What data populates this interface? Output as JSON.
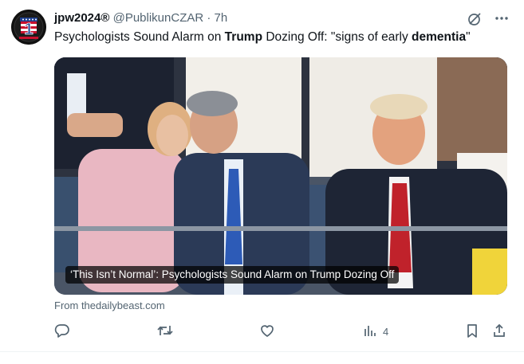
{
  "post": {
    "display_name": "jpw2024®",
    "handle": "@PublikunCZAR",
    "separator": "·",
    "time": "7h",
    "text_parts": [
      "Psychologists Sound Alarm on ",
      "Trump",
      " Dozing Off: \"signs of early ",
      "dementia",
      "\""
    ],
    "card_caption": "‘This Isn’t Normal’: Psychologists Sound Alarm on Trump Dozing Off",
    "source": "From thedailybeast.com",
    "views_count": "4",
    "avatar_number": "1"
  },
  "icons": {
    "grok": "grok-icon",
    "more": "more-icon",
    "reply": "reply-icon",
    "repost": "repost-icon",
    "like": "like-icon",
    "views": "views-icon",
    "bookmark": "bookmark-icon",
    "share": "share-icon"
  },
  "colors": {
    "text_primary": "#0f1419",
    "text_secondary": "#536471",
    "divider": "#eff3f4"
  }
}
